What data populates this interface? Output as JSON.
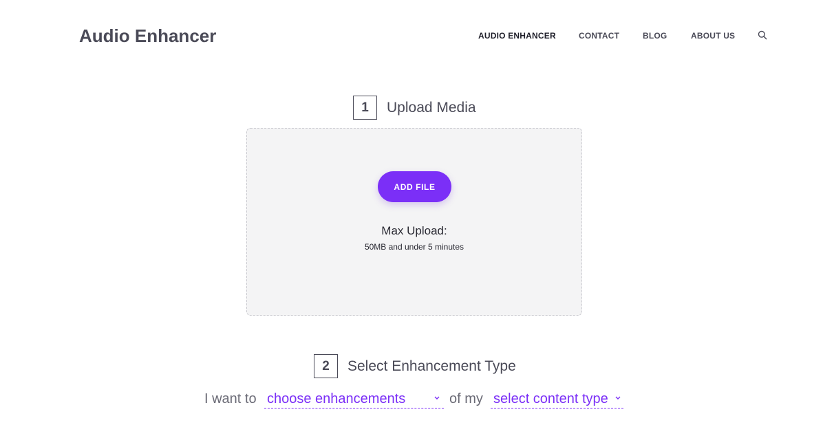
{
  "header": {
    "brand": "Audio Enhancer",
    "nav": [
      {
        "label": "AUDIO ENHANCER",
        "active": true
      },
      {
        "label": "CONTACT",
        "active": false
      },
      {
        "label": "BLOG",
        "active": false
      },
      {
        "label": "ABOUT US",
        "active": false
      }
    ],
    "search_icon": "search-icon"
  },
  "step1": {
    "number": "1",
    "title": "Upload Media",
    "button_label": "ADD FILE",
    "max_label": "Max Upload:",
    "max_detail": "50MB and under 5 minutes"
  },
  "step2": {
    "number": "2",
    "title": "Select Enhancement Type",
    "prefix": "I want to",
    "enhancements_value": "choose enhancements",
    "middle": "of my",
    "content_type_value": "select content type"
  },
  "colors": {
    "accent": "#7b2ff7",
    "text": "#4a4a57",
    "dropzone_bg": "#f4f4f5"
  }
}
